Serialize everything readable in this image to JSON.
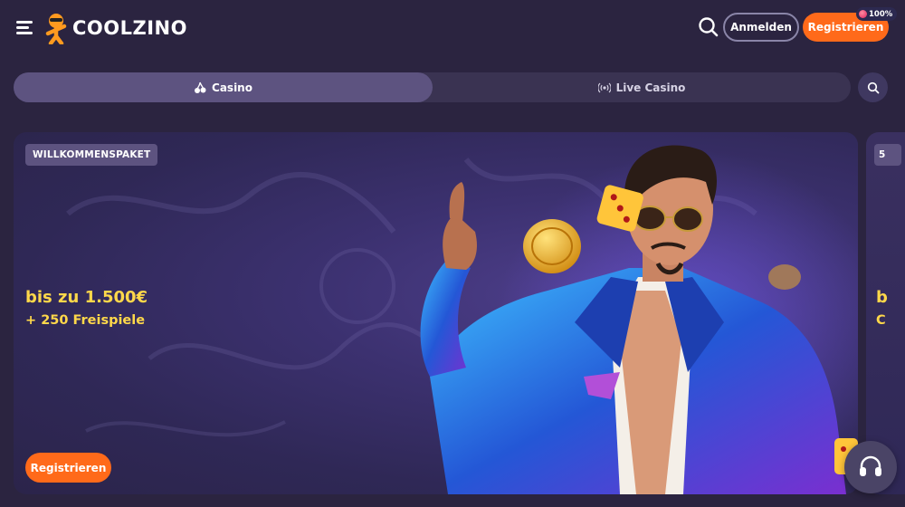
{
  "header": {
    "logo_text": "COOLZINO",
    "login_label": "Anmelden",
    "register_label": "Registrieren",
    "badge_text": "100%",
    "icons": [
      "menu-icon",
      "logo-icon",
      "search-icon"
    ]
  },
  "tabs": [
    {
      "label": "Casino",
      "icon": "cherry-icon",
      "active": true
    },
    {
      "label": "Live Casino",
      "icon": "broadcast-icon",
      "active": false
    }
  ],
  "banner": {
    "tag": "WILLKOMMENSPAKET",
    "amount": "bis zu 1.500€",
    "spins": "+ 250 Freispiele",
    "cta": "Registrieren"
  },
  "next_banner": {
    "tag": "5",
    "amount": "b",
    "sub": "C"
  },
  "colors": {
    "background": "#2b2440",
    "accent": "#ff6a1a",
    "highlight": "#ffd84a",
    "tab_active": "#5d5380"
  }
}
